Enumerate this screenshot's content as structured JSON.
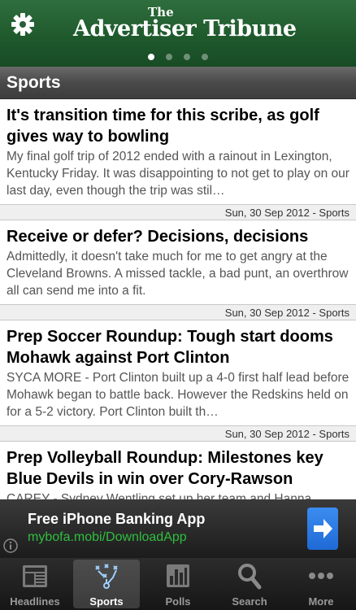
{
  "header": {
    "masthead_the": "The",
    "masthead_name": "Advertiser Tribune",
    "page_count": 4,
    "active_page": 1
  },
  "section": {
    "title": "Sports"
  },
  "articles": [
    {
      "title": "It's transition time for this scribe, as golf gives way to bowling",
      "summary": "My final golf trip of 2012 ended with a rainout in Lexington, Kentucky Friday. It was disappointing to not get to play on our last day, even though the trip was stil…",
      "meta": "Sun, 30 Sep 2012 - Sports"
    },
    {
      "title": "Receive or defer? Decisions, decisions",
      "summary": "Admittedly, it doesn't take much for me to get angry at the Cleveland Browns. A missed tackle, a bad punt, an overthrow all can send me into a fit.",
      "meta": "Sun, 30 Sep 2012 - Sports"
    },
    {
      "title": "Prep Soccer Roundup: Tough start dooms Mohawk against Port Clinton",
      "summary": "SYCA MORE - Port Clinton built up a 4-0 first half lead before Mohawk began to battle back. However the Redskins held on for a 5-2 victory.  Port Clinton built th…",
      "meta": "Sun, 30 Sep 2012 - Sports"
    },
    {
      "title": "Prep Volleyball Roundup: Milestones key Blue Devils in win over Cory-Rawson",
      "summary": "CAREY - Sydney Wentling set up her team and Hanna",
      "meta": ""
    }
  ],
  "ad": {
    "title": "Free iPhone Banking App",
    "url": "mybofa.mobi/DownloadApp",
    "url_color": "#2fbf3f"
  },
  "tabs": [
    {
      "label": "Headlines",
      "icon": "newspaper-icon"
    },
    {
      "label": "Sports",
      "icon": "playbook-icon"
    },
    {
      "label": "Polls",
      "icon": "bar-chart-icon"
    },
    {
      "label": "Search",
      "icon": "magnifier-icon"
    },
    {
      "label": "More",
      "icon": "more-dots-icon"
    }
  ],
  "colors": {
    "header_green": "#1f5a2d",
    "section_gray": "#4a4a4a",
    "ad_arrow_blue": "#1f6ad6"
  }
}
